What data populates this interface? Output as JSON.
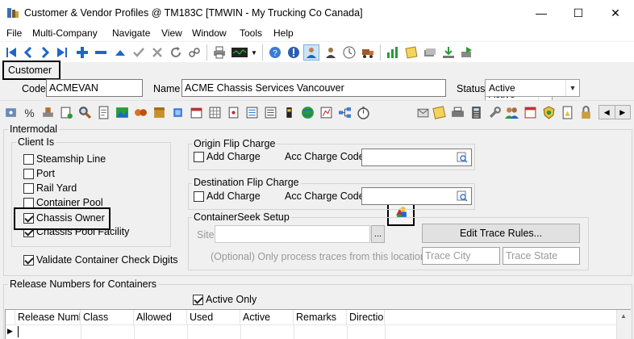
{
  "window": {
    "title": "Customer & Vendor Profiles @ TM183C [TMWIN - My Trucking Co Canada]",
    "minimize_glyph": "—",
    "maximize_glyph": "☐",
    "close_glyph": "✕"
  },
  "menu": [
    "File",
    "Multi-Company",
    "Navigate",
    "View",
    "Window",
    "Tools",
    "Help"
  ],
  "toolbar": {
    "status_filter": "Active"
  },
  "tab": {
    "label": "Customer"
  },
  "header": {
    "code_label": "Code",
    "code_value": "ACMEVAN",
    "name_label": "Name",
    "name_value": "ACME Chassis Services Vancouver",
    "status_label": "Status",
    "status_value": "Active"
  },
  "intermodal": {
    "title": "Intermodal",
    "client_is": {
      "title": "Client Is",
      "items": [
        {
          "label": "Steamship Line",
          "checked": false
        },
        {
          "label": "Port",
          "checked": false
        },
        {
          "label": "Rail Yard",
          "checked": false
        },
        {
          "label": "Container Pool",
          "checked": false
        },
        {
          "label": "Chassis Owner",
          "checked": true
        },
        {
          "label": "Chassis Pool Facility",
          "checked": true
        }
      ]
    },
    "validate_label": "Validate Container Check Digits",
    "validate_checked": true,
    "origin_flip": {
      "title": "Origin Flip Charge",
      "add_charge": "Add Charge",
      "acc_charge_code": "Acc Charge Code"
    },
    "destination_flip": {
      "title": "Destination Flip Charge",
      "add_charge": "Add Charge",
      "acc_charge_code": "Acc Charge Code"
    },
    "container_seek": {
      "title": "ContainerSeek Setup",
      "site_label": "Site",
      "browse_label": "...",
      "edit_trace_rules": "Edit Trace Rules...",
      "optional_text": "(Optional) Only process traces from this location:",
      "trace_city_placeholder": "Trace City",
      "trace_state_placeholder": "Trace State"
    }
  },
  "release": {
    "title": "Release Numbers for Containers",
    "active_only_label": "Active Only",
    "active_only_checked": true,
    "columns": [
      "Release Numb",
      "Class",
      "Allowed",
      "Used",
      "Active",
      "Remarks",
      "Directio"
    ]
  },
  "colors": {
    "accent": "#1e66c8",
    "highlight_border": "#000000"
  }
}
